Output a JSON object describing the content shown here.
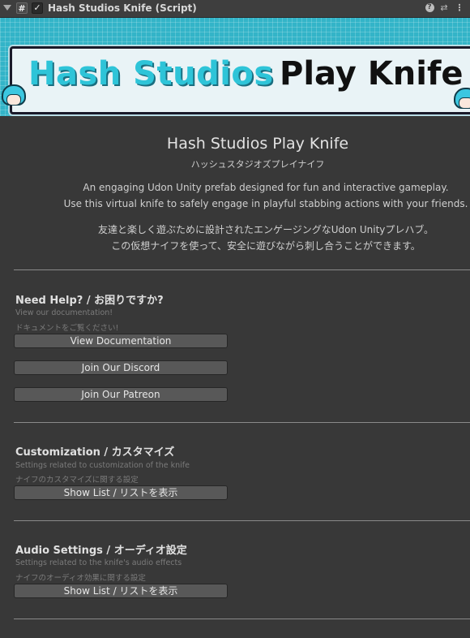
{
  "component": {
    "title": "Hash Studios Knife (Script)",
    "script_icon_glyph": "#",
    "enabled_glyph": "✓",
    "help_glyph": "?",
    "preset_glyph": "⇄",
    "more_glyph": "⋮"
  },
  "banner": {
    "brand": "Hash Studios",
    "product": "Play Knife"
  },
  "intro": {
    "title": "Hash Studios Play Knife",
    "title_jp": "ハッシュスタジオズプレイナイフ",
    "desc_en_1": "An engaging Udon Unity prefab designed for fun and interactive gameplay.",
    "desc_en_2": "Use this virtual knife to safely engage in playful stabbing actions with your friends.",
    "desc_jp_1": "友達と楽しく遊ぶために設計されたエンゲージングなUdon Unityプレハブ。",
    "desc_jp_2": "この仮想ナイフを使って、安全に遊びながら刺し合うことができます。"
  },
  "help": {
    "title": "Need Help? / お困りですか?",
    "sub_en": "View our documentation!",
    "sub_jp": "ドキュメントをご覧ください!",
    "buttons": [
      "View Documentation",
      "Join Our Discord",
      "Join Our Patreon"
    ]
  },
  "customization": {
    "title": "Customization / カスタマイズ",
    "sub_en": "Settings related to customization of the knife",
    "sub_jp": "ナイフのカスタマイズに関する設定",
    "button": "Show List / リストを表示"
  },
  "audio": {
    "title": "Audio Settings / オーディオ設定",
    "sub_en": "Settings related to the knife's audio effects",
    "sub_jp": "ナイフのオーディオ効果に関する設定",
    "button": "Show List / リストを表示"
  },
  "colors": {
    "background": "#383838",
    "button": "#585858",
    "banner_accent": "#33b4c8"
  }
}
